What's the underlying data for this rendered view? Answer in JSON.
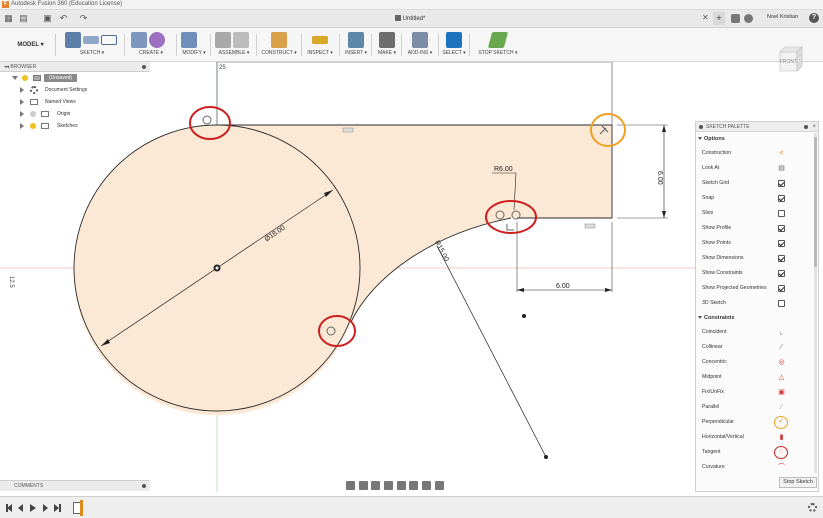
{
  "window": {
    "title": "Autodesk Fusion 360 (Education License)"
  },
  "tabs": {
    "document": "Untitled*",
    "user": "Noel Kristian",
    "help": "?"
  },
  "toolbar": {
    "workspace": "MODEL ▾",
    "groups": [
      {
        "label": "SKETCH ▾"
      },
      {
        "label": "CREATE ▾"
      },
      {
        "label": "MODIFY ▾"
      },
      {
        "label": "ASSEMBLE ▾"
      },
      {
        "label": "CONSTRUCT ▾"
      },
      {
        "label": "INSPECT ▾"
      },
      {
        "label": "INSERT ▾"
      },
      {
        "label": "MAKE ▾"
      },
      {
        "label": "ADD-INS ▾"
      },
      {
        "label": "SELECT ▾"
      },
      {
        "label": "STOP SKETCH ▾"
      }
    ]
  },
  "viewcube": {
    "face": "FRONT",
    "axis_z": "Z",
    "axis_x": "X"
  },
  "browser": {
    "title": "BROWSER",
    "items": [
      {
        "label": "(Unsaved)"
      },
      {
        "label": "Document Settings"
      },
      {
        "label": "Named Views"
      },
      {
        "label": "Origin"
      },
      {
        "label": "Sketches"
      }
    ]
  },
  "sketch": {
    "dims": {
      "diameter": "Ø18.00",
      "radius_small": "R6.00",
      "radius_large": "R15.00",
      "height": "6.00",
      "width": "6.00",
      "top_axis": "25",
      "left_axis": "12.5"
    }
  },
  "palette": {
    "title": "SKETCH PALETTE",
    "close": "×",
    "options_title": "Options",
    "options": [
      {
        "label": "Construction",
        "icon": "construction-icon"
      },
      {
        "label": "Look At",
        "icon": "look-at-icon"
      },
      {
        "label": "Sketch Grid",
        "checked": true
      },
      {
        "label": "Snap",
        "checked": true
      },
      {
        "label": "Slice",
        "checked": false
      },
      {
        "label": "Show Profile",
        "checked": true
      },
      {
        "label": "Show Points",
        "checked": true
      },
      {
        "label": "Show Dimensions",
        "checked": true
      },
      {
        "label": "Show Constraints",
        "checked": true
      },
      {
        "label": "Show Projected Geometries",
        "checked": true
      },
      {
        "label": "3D Sketch",
        "checked": false
      }
    ],
    "constraints_title": "Constraints",
    "constraints": [
      {
        "label": "Coincident",
        "icon": "coincident-icon"
      },
      {
        "label": "Collinear",
        "icon": "collinear-icon"
      },
      {
        "label": "Concentric",
        "icon": "concentric-icon"
      },
      {
        "label": "Midpoint",
        "icon": "midpoint-icon"
      },
      {
        "label": "Fix/UnFix",
        "icon": "lock-icon"
      },
      {
        "label": "Parallel",
        "icon": "parallel-icon"
      },
      {
        "label": "Perpendicular",
        "icon": "perpendicular-icon"
      },
      {
        "label": "Horizontal/Vertical",
        "icon": "horizontal-vertical-icon"
      },
      {
        "label": "Tangent",
        "icon": "tangent-icon"
      },
      {
        "label": "Curvature",
        "icon": "curvature-icon"
      }
    ],
    "stop_button": "Stop Sketch"
  },
  "comments": {
    "title": "COMMENTS"
  },
  "colors": {
    "annotation_red": "#cc1f1f",
    "annotation_orange": "#f0a020",
    "profile_fill": "#fbe9d6",
    "accent_blue": "#1e73be"
  }
}
